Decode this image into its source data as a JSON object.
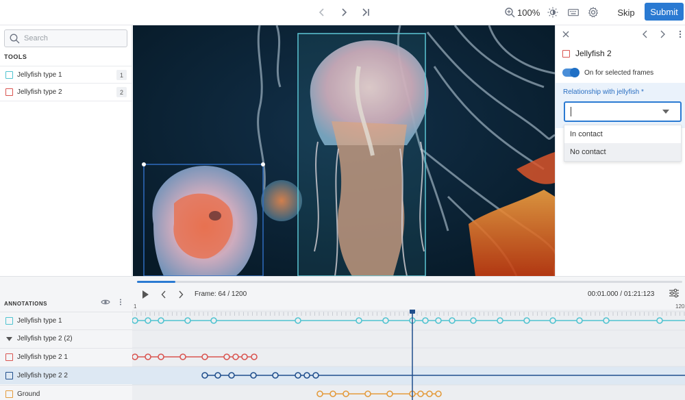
{
  "topbar": {
    "zoom_label": "100%",
    "skip_label": "Skip",
    "submit_label": "Submit",
    "accent_color": "#2a7ad2"
  },
  "left_panel": {
    "search_placeholder": "Search",
    "tools_title": "TOOLS",
    "tools": [
      {
        "label": "Jellyfish type 1",
        "key": "1",
        "color": "#4fc3d0"
      },
      {
        "label": "Jellyfish type 2",
        "key": "2",
        "color": "#d9534f"
      }
    ]
  },
  "right_panel": {
    "object_title": "Jellyfish 2",
    "toggle_label": "On for selected frames",
    "relationship_label": "Relationship with jellyfish *",
    "select_value": "",
    "options": [
      "In contact",
      "No contact"
    ]
  },
  "timeline": {
    "progress": 0.07,
    "frame_label": "Frame: 64 / 1200",
    "time_label": "00:01.000 / 01:21:123",
    "tick_start": "1",
    "tick_end": "120",
    "annotations_title": "ANNOTATIONS",
    "annotations": [
      {
        "label": "Jellyfish type 1",
        "color": "#4fc3d0",
        "type": "box"
      },
      {
        "label": "Jellyfish type 2 (2)",
        "color": "#555555",
        "type": "group"
      },
      {
        "label": "Jellyfish type 2 1",
        "color": "#d9534f",
        "type": "box"
      },
      {
        "label": "Jellyfish type 2 2",
        "color": "#1f4e8c",
        "type": "box"
      },
      {
        "label": "Ground",
        "color": "#e39a3b",
        "type": "box"
      }
    ]
  }
}
